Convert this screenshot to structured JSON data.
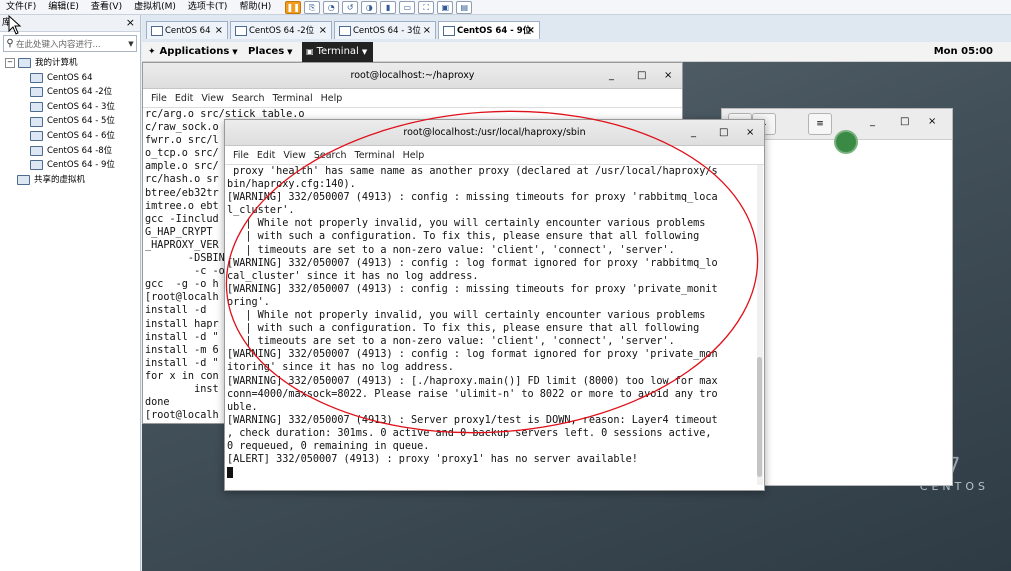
{
  "vmware": {
    "menu": [
      "文件(F)",
      "编辑(E)",
      "查看(V)",
      "虚拟机(M)",
      "选项卡(T)",
      "帮助(H)"
    ],
    "library": {
      "title": "库",
      "search_placeholder": "在此处键入内容进行...",
      "root": "我的计算机",
      "machines": [
        "CentOS 64",
        "CentOS 64 -2位",
        "CentOS 64 - 3位",
        "CentOS 64 - 5位",
        "CentOS 64 - 6位",
        "CentOS 64 -8位",
        "CentOS 64 - 9位"
      ],
      "shared": "共享的虚拟机"
    },
    "tabs": [
      {
        "label": "CentOS 64"
      },
      {
        "label": "CentOS 64 -2位"
      },
      {
        "label": "CentOS 64 - 3位"
      },
      {
        "label": "CentOS 64 - 9位"
      }
    ]
  },
  "guest": {
    "topbar": {
      "applications": "Applications",
      "places": "Places",
      "terminal": "Terminal",
      "clock": "Mon 05:00"
    },
    "brand": "CENTOS",
    "brand_number": "7",
    "term_back": {
      "title": "root@localhost:~/haproxy",
      "menu": [
        "File",
        "Edit",
        "View",
        "Search",
        "Terminal",
        "Help"
      ],
      "lines": [
        "rc/arg.o src/stick_table.o",
        "c/raw_sock.o",
        "fwrr.o src/l",
        "o_tcp.o src/",
        "ample.o src/",
        "rc/hash.o sr",
        "btree/eb32tr",
        "imtree.o ebt",
        "gcc -Iinclud",
        "G_HAP_CRYPT ",
        "_HAPROXY_VER",
        "       -DSBIN",
        "        -c -o",
        "gcc  -g -o h",
        "[root@localh",
        "install -d ",
        "install hapr",
        "install -d \"",
        "install -m 6",
        "install -d \"",
        "for x in con",
        "        inst",
        "done",
        "[root@localh"
      ]
    },
    "term_front": {
      "title": "root@localhost:/usr/local/haproxy/sbin",
      "menu": [
        "File",
        "Edit",
        "View",
        "Search",
        "Terminal",
        "Help"
      ],
      "lines": [
        " proxy 'health' has same name as another proxy (declared at /usr/local/haproxy/s",
        "bin/haproxy.cfg:140).",
        "[WARNING] 332/050007 (4913) : config : missing timeouts for proxy 'rabbitmq_loca",
        "l_cluster'.",
        "   | While not properly invalid, you will certainly encounter various problems",
        "   | with such a configuration. To fix this, please ensure that all following",
        "   | timeouts are set to a non-zero value: 'client', 'connect', 'server'.",
        "[WARNING] 332/050007 (4913) : config : log format ignored for proxy 'rabbitmq_lo",
        "cal_cluster' since it has no log address.",
        "[WARNING] 332/050007 (4913) : config : missing timeouts for proxy 'private_monit",
        "oring'.",
        "   | While not properly invalid, you will certainly encounter various problems",
        "   | with such a configuration. To fix this, please ensure that all following",
        "   | timeouts are set to a non-zero value: 'client', 'connect', 'server'.",
        "[WARNING] 332/050007 (4913) : config : log format ignored for proxy 'private_mon",
        "itoring' since it has no log address.",
        "[WARNING] 332/050007 (4913) : [./haproxy.main()] FD limit (8000) too low for max",
        "conn=4000/maxsock=8022. Please raise 'ulimit-n' to 8022 or more to avoid any tro",
        "uble.",
        "[WARNING] 332/050007 (4913) : Server proxy1/test is DOWN, reason: Layer4 timeout",
        ", check duration: 301ms. 0 active and 0 backup servers left. 0 sessions active,",
        "0 requeued, 0 remaining in queue.",
        "[ALERT] 332/050007 (4913) : proxy 'proxy1' has no server available!"
      ]
    }
  },
  "colors": {
    "annotation": "#e0101a",
    "gnome_bar": "#f3f3f3",
    "hand_button": "#3a8a46"
  }
}
